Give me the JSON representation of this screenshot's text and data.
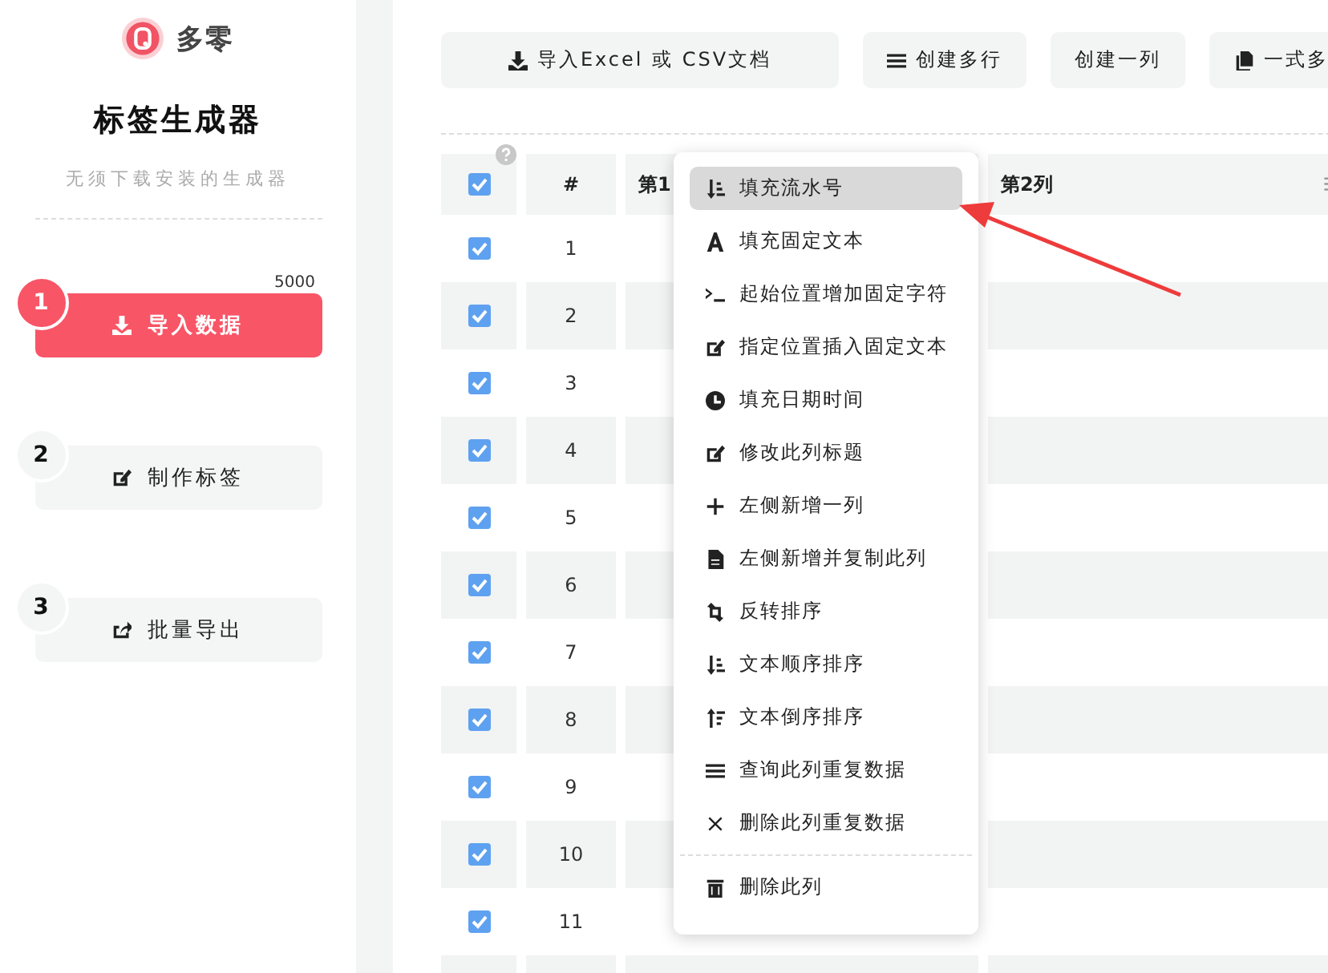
{
  "sidebar": {
    "logo_text": "多零",
    "title": "标签生成器",
    "subtitle": "无须下载安装的生成器",
    "steps": [
      {
        "number": "1",
        "label": "导入数据",
        "count": "5000",
        "selected": true
      },
      {
        "number": "2",
        "label": "制作标签",
        "selected": false
      },
      {
        "number": "3",
        "label": "批量导出",
        "selected": false
      }
    ]
  },
  "toolbar": {
    "buttons": [
      "导入Excel 或 CSV文档",
      "创建多行",
      "创建一列",
      "一式多"
    ]
  },
  "table": {
    "header_checked": true,
    "columns": [
      "#",
      "第1",
      "第2列"
    ],
    "rows": [
      {
        "number": "1",
        "checked": true
      },
      {
        "number": "2",
        "checked": true
      },
      {
        "number": "3",
        "checked": true
      },
      {
        "number": "4",
        "checked": true
      },
      {
        "number": "5",
        "checked": true
      },
      {
        "number": "6",
        "checked": true
      },
      {
        "number": "7",
        "checked": true
      },
      {
        "number": "8",
        "checked": true
      },
      {
        "number": "9",
        "checked": true
      },
      {
        "number": "10",
        "checked": true
      },
      {
        "number": "11",
        "checked": true
      }
    ]
  },
  "context_menu": {
    "groups": [
      [
        {
          "label": "填充流水号",
          "selected": true
        },
        {
          "label": "填充固定文本",
          "selected": false
        },
        {
          "label": "起始位置增加固定字符",
          "selected": false
        },
        {
          "label": "指定位置插入固定文本",
          "selected": false
        },
        {
          "label": "填充日期时间",
          "selected": false
        },
        {
          "label": "修改此列标题",
          "selected": false
        },
        {
          "label": "左侧新增一列",
          "selected": false
        },
        {
          "label": "左侧新增并复制此列",
          "selected": false
        },
        {
          "label": "反转排序",
          "selected": false
        },
        {
          "label": "文本顺序排序",
          "selected": false
        },
        {
          "label": "文本倒序排序",
          "selected": false
        },
        {
          "label": "查询此列重复数据",
          "selected": false
        },
        {
          "label": "删除此列重复数据",
          "selected": false
        }
      ],
      [
        {
          "label": "删除此列",
          "selected": false
        }
      ]
    ]
  }
}
